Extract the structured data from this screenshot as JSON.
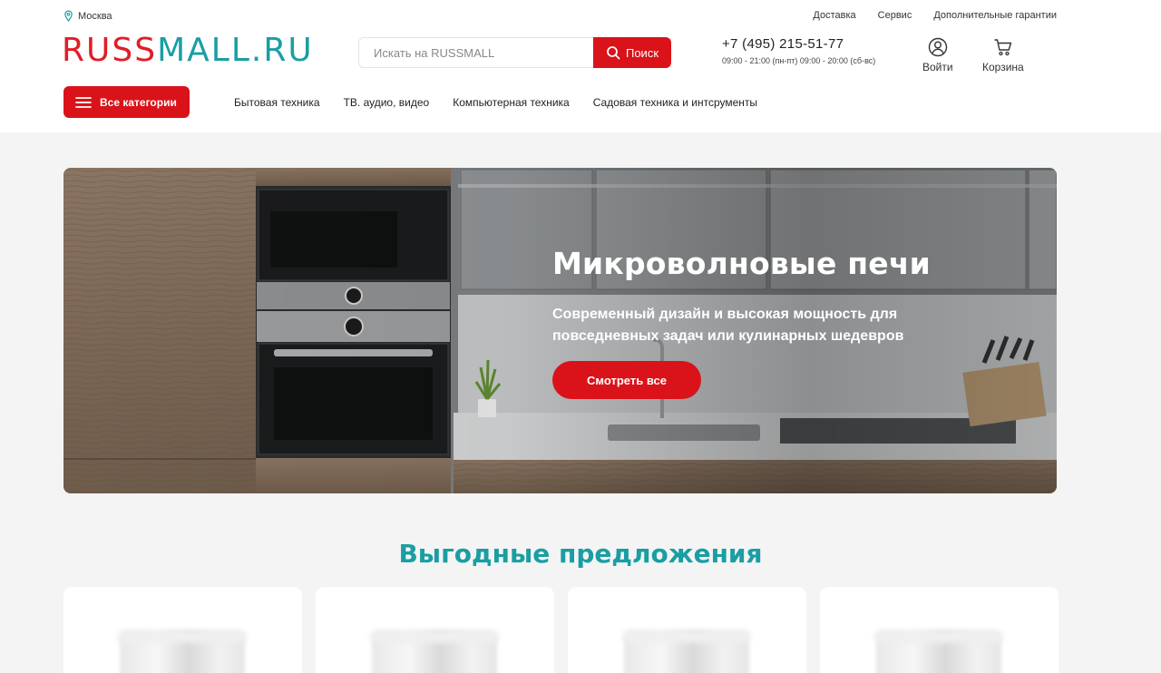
{
  "header": {
    "city": "Москва",
    "top_links": [
      "Доставка",
      "Сервис",
      "Дополнительные гарантии"
    ],
    "logo": {
      "part1": "RUSS",
      "part2": "MALL.RU"
    },
    "search": {
      "placeholder": "Искать на RUSSMALL",
      "button_label": "Поиск"
    },
    "phone": "+7 (495) 215-51-77",
    "hours": "09:00 - 21:00 (пн-пт) 09:00 - 20:00 (сб-вс)",
    "login_label": "Войти",
    "cart_label": "Корзина",
    "all_categories_label": "Все категории",
    "nav": [
      "Бытовая техника",
      "ТВ. аудио, видео",
      "Компьютерная техника",
      "Садовая техника и интсрументы"
    ]
  },
  "banner": {
    "title": "Микроволновые печи",
    "subtitle": "Современный дизайн и высокая мощность для повседневных задач или кулинарных шедевров",
    "button_label": "Смотреть все"
  },
  "offers": {
    "title": "Выгодные предложения",
    "card_count": 4
  },
  "colors": {
    "brand_red": "#d91319",
    "brand_teal": "#1a9ea3",
    "logo_red": "#df1e26"
  },
  "icons": {
    "city": "location-pin-icon",
    "search": "search-icon",
    "login": "user-icon",
    "cart": "cart-icon",
    "menu": "hamburger-icon"
  }
}
